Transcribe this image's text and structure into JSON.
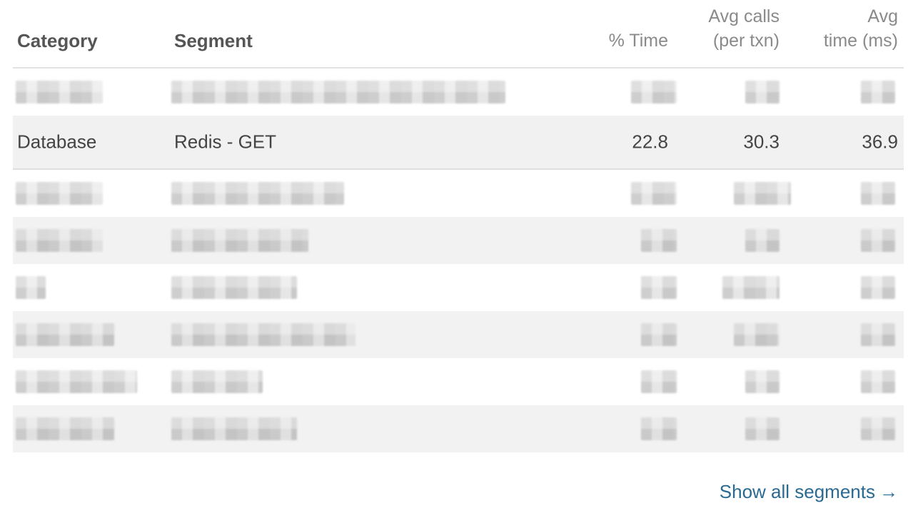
{
  "table": {
    "headers": {
      "category": "Category",
      "segment": "Segment",
      "pct_time": "% Time",
      "avg_calls_line1": "Avg calls",
      "avg_calls_line2": "(per txn)",
      "avg_time_line1": "Avg",
      "avg_time_line2": "time (ms)"
    },
    "highlighted_row": {
      "category": "Database",
      "segment": "Redis - GET",
      "pct_time": "22.8",
      "avg_calls": "30.3",
      "avg_time": "36.9"
    }
  },
  "footer": {
    "link_label": "Show all segments",
    "arrow": "→"
  },
  "colors": {
    "link": "#2a6a92",
    "header_bold": "#555555",
    "header_light": "#8a8a8a",
    "row_alt": "#f2f2f2"
  }
}
